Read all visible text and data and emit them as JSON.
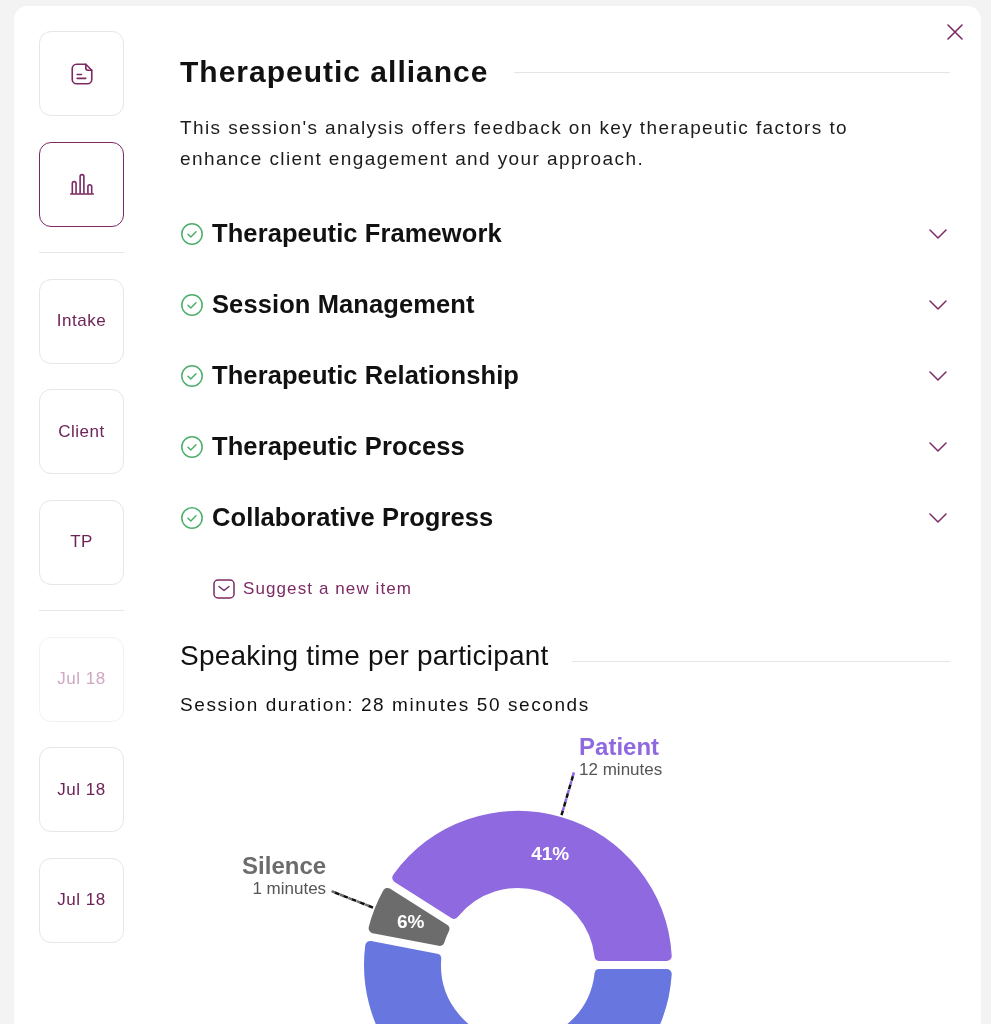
{
  "sidebar": {
    "tools": [
      {
        "kind": "notes",
        "selected": false
      },
      {
        "kind": "chart",
        "selected": true
      }
    ],
    "sections": [
      {
        "label": "Intake",
        "selected": false
      },
      {
        "label": "Client",
        "selected": false
      },
      {
        "label": "TP",
        "selected": false
      }
    ],
    "sessions": [
      {
        "label": "Jul 18",
        "disabled": true,
        "selected": false
      },
      {
        "label": "Jul 18",
        "disabled": false,
        "selected": false
      },
      {
        "label": "Jul 18",
        "disabled": false,
        "selected": false
      }
    ]
  },
  "alliance": {
    "title": "Therapeutic alliance",
    "description": "This session's analysis offers feedback on key therapeutic factors to enhance client engagement and your approach.",
    "factors": [
      {
        "title": "Therapeutic Framework",
        "completed": true,
        "expanded": false
      },
      {
        "title": "Session Management",
        "completed": true,
        "expanded": false
      },
      {
        "title": "Therapeutic Relationship",
        "completed": true,
        "expanded": false
      },
      {
        "title": "Therapeutic Process",
        "completed": true,
        "expanded": false
      },
      {
        "title": "Collaborative Progress",
        "completed": true,
        "expanded": false
      }
    ],
    "suggest_link": "Suggest a new item"
  },
  "speaking_time": {
    "title": "Speaking time per participant",
    "duration": "Session duration: 28 minutes 50 seconds",
    "chart_data": {
      "type": "donut",
      "categories": [
        "Patient",
        "Silence",
        null
      ],
      "values": [
        41,
        6,
        53
      ],
      "colors": [
        "#8f69e0",
        "#6c6c6c",
        "#6876df"
      ],
      "value_labels": [
        "41%",
        "6%",
        null
      ],
      "annotations": [
        "12 minutes",
        "1 minutes",
        null
      ]
    }
  }
}
